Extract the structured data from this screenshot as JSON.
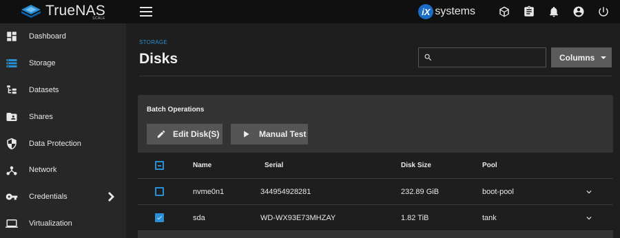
{
  "app": {
    "brand": "TrueNAS",
    "brand_sub": "SCALE",
    "vendor_mark": "iX",
    "vendor_text": "systems",
    "accent": "#2b8fd6"
  },
  "topbar": {
    "icons": [
      "menu-icon",
      "truecommand-icon",
      "clipboard-icon",
      "bell-icon",
      "account-icon",
      "power-icon"
    ]
  },
  "sidebar": {
    "items": [
      {
        "label": "Dashboard",
        "icon": "dashboard-icon",
        "active": false
      },
      {
        "label": "Storage",
        "icon": "storage-icon",
        "active": true
      },
      {
        "label": "Datasets",
        "icon": "datasets-icon",
        "active": false
      },
      {
        "label": "Shares",
        "icon": "shares-icon",
        "active": false
      },
      {
        "label": "Data Protection",
        "icon": "shield-icon",
        "active": false
      },
      {
        "label": "Network",
        "icon": "network-icon",
        "active": false
      },
      {
        "label": "Credentials",
        "icon": "key-icon",
        "active": false,
        "has_children": true
      },
      {
        "label": "Virtualization",
        "icon": "laptop-icon",
        "active": false
      }
    ]
  },
  "page": {
    "breadcrumb": "STORAGE",
    "title": "Disks",
    "search_value": "",
    "columns_label": "Columns"
  },
  "batch": {
    "title": "Batch Operations",
    "edit_label": "Edit Disk(S)",
    "test_label": "Manual Test"
  },
  "table": {
    "headers": {
      "name": "Name",
      "serial": "Serial",
      "size": "Disk Size",
      "pool": "Pool"
    },
    "select_all_state": "indeterminate",
    "rows": [
      {
        "name": "nvme0n1",
        "serial": "344954928281",
        "size": "232.89 GiB",
        "pool": "boot-pool",
        "selected": false
      },
      {
        "name": "sda",
        "serial": "WD-WX93E73MHZAY",
        "size": "1.82 TiB",
        "pool": "tank",
        "selected": true
      }
    ]
  }
}
